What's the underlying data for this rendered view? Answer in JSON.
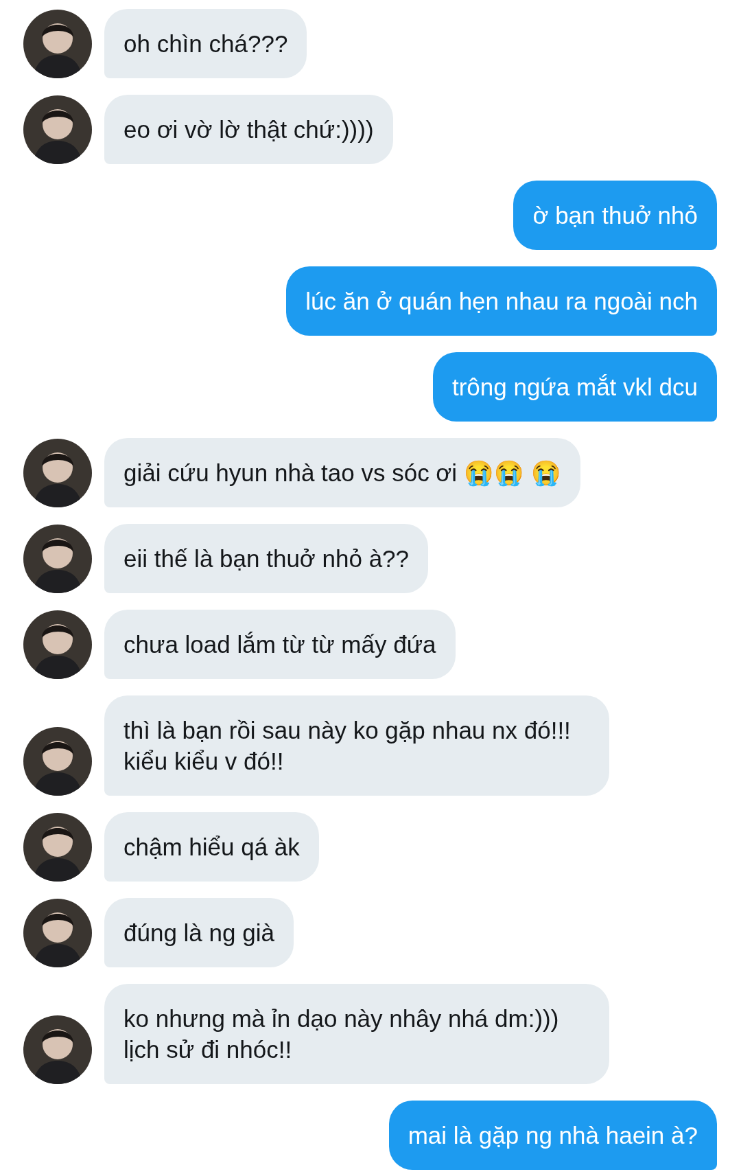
{
  "messages": [
    {
      "kind": "incoming",
      "text": "oh chìn chá???"
    },
    {
      "kind": "incoming",
      "text": "eo ơi vờ lờ thật chứ:))))"
    },
    {
      "kind": "outgoing",
      "text": "ờ bạn thuở nhỏ"
    },
    {
      "kind": "outgoing",
      "text": "lúc ăn ở quán hẹn nhau ra ngoài nch"
    },
    {
      "kind": "outgoing",
      "text": "trông ngứa mắt vkl dcu"
    },
    {
      "kind": "incoming",
      "text": "giải cứu hyun nhà tao vs sóc ơi 😭😭 😭"
    },
    {
      "kind": "incoming",
      "text": "eii thế là bạn thuở nhỏ à??"
    },
    {
      "kind": "incoming",
      "text": "chưa load lắm từ từ mấy đứa"
    },
    {
      "kind": "incoming",
      "text": "thì là bạn rồi sau này ko gặp nhau nx đó!!! kiểu kiểu v đó!!"
    },
    {
      "kind": "incoming",
      "text": "chậm hiểu qá àk"
    },
    {
      "kind": "incoming",
      "text": "đúng là ng già"
    },
    {
      "kind": "incoming",
      "text": "ko nhưng mà ỉn dạo này nhây nhá dm:))) lịch sử đi nhóc!!"
    },
    {
      "kind": "outgoing",
      "text": "mai là gặp ng nhà haein à?"
    }
  ]
}
